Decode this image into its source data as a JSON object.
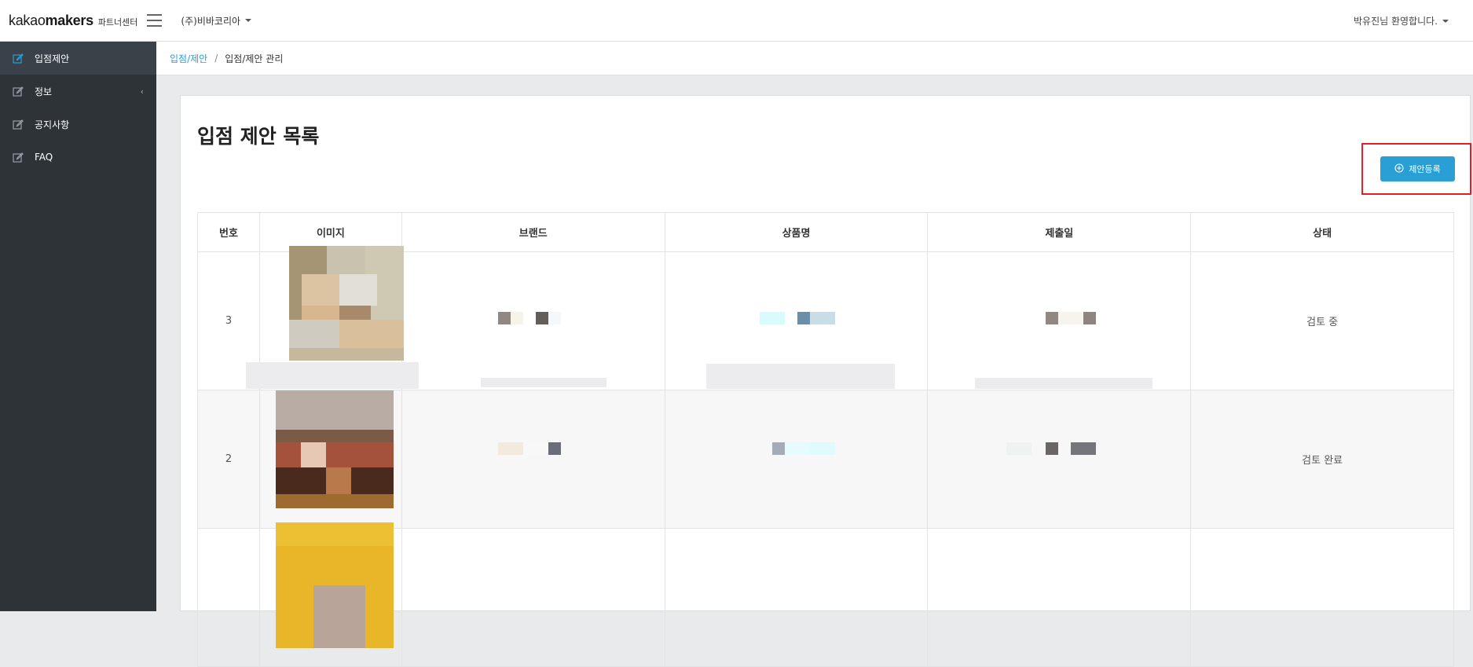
{
  "header": {
    "logo_regular": "kakao",
    "logo_bold": "makers",
    "logo_sub": "파트너센터",
    "company": "(주)비바코리아",
    "welcome": "박유진님 환영합니다."
  },
  "sidebar": {
    "items": [
      {
        "label": "입점제안",
        "icon": "edit-icon",
        "active": true
      },
      {
        "label": "정보",
        "icon": "edit-icon",
        "has_submenu": true
      },
      {
        "label": "공지사항",
        "icon": "edit-icon"
      },
      {
        "label": "FAQ",
        "icon": "edit-icon"
      }
    ]
  },
  "breadcrumb": {
    "parent": "입점/제안",
    "separator": "/",
    "current": "입점/제안 관리"
  },
  "main": {
    "title": "입점 제안 목록",
    "add_button_label": "제안등록",
    "add_button_icon": "plus-circle-icon",
    "accent_color": "#2a9fd6",
    "highlight_color": "#e0212a"
  },
  "table": {
    "columns": [
      "번호",
      "이미지",
      "브랜드",
      "상품명",
      "제출일",
      "상태"
    ],
    "rows": [
      {
        "number": "3",
        "status": "검토 중"
      },
      {
        "number": "2",
        "status": "검토 완료"
      },
      {
        "number": "",
        "status": ""
      }
    ]
  }
}
